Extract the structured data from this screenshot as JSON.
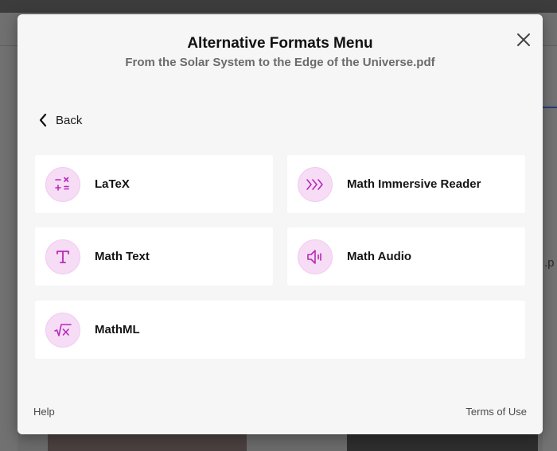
{
  "modal": {
    "title": "Alternative Formats Menu",
    "subtitle": "From the Solar System to the Edge of the Universe.pdf",
    "back_label": "Back"
  },
  "options": [
    {
      "label": "LaTeX",
      "icon": "latex-operators-icon"
    },
    {
      "label": "Math Immersive Reader",
      "icon": "immersive-reader-chevrons-icon"
    },
    {
      "label": "Math Text",
      "icon": "text-t-icon"
    },
    {
      "label": "Math Audio",
      "icon": "speaker-icon"
    },
    {
      "label": "MathML",
      "icon": "square-root-x-icon"
    }
  ],
  "footer": {
    "help_label": "Help",
    "terms_label": "Terms of Use"
  },
  "background": {
    "right_edge_text": ".p"
  },
  "colors": {
    "accent": "#b42bb8",
    "icon_bg": "#f7dcf6",
    "modal_bg": "#f6f6f7",
    "card_bg": "#ffffff"
  }
}
